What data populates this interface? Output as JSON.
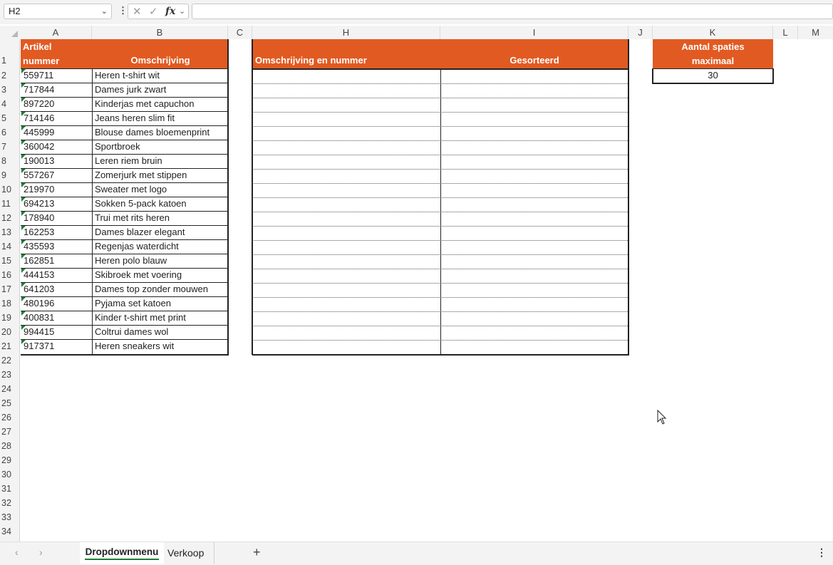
{
  "name_box": "H2",
  "formula_bar": {
    "fx_label": "fx",
    "formula": ""
  },
  "columns": [
    "A",
    "B",
    "C",
    "H",
    "I",
    "J",
    "K",
    "L",
    "M"
  ],
  "rows": [
    "1",
    "2",
    "3",
    "4",
    "5",
    "6",
    "7",
    "8",
    "9",
    "10",
    "11",
    "12",
    "13",
    "14",
    "15",
    "16",
    "17",
    "18",
    "19",
    "20",
    "21",
    "22",
    "23",
    "24",
    "25",
    "26",
    "27",
    "28",
    "29",
    "30",
    "31",
    "32",
    "33",
    "34"
  ],
  "table1": {
    "header_a_line1": "Artikel",
    "header_a_line2": "nummer",
    "header_b": "Omschrijving",
    "items": [
      {
        "nummer": "559711",
        "omschrijving": "Heren t-shirt wit"
      },
      {
        "nummer": "717844",
        "omschrijving": "Dames jurk zwart"
      },
      {
        "nummer": "897220",
        "omschrijving": "Kinderjas met capuchon"
      },
      {
        "nummer": "714146",
        "omschrijving": "Jeans heren slim fit"
      },
      {
        "nummer": "445999",
        "omschrijving": "Blouse dames bloemenprint"
      },
      {
        "nummer": "360042",
        "omschrijving": "Sportbroek"
      },
      {
        "nummer": "190013",
        "omschrijving": "Leren riem bruin"
      },
      {
        "nummer": "557267",
        "omschrijving": "Zomerjurk met stippen"
      },
      {
        "nummer": "219970",
        "omschrijving": "Sweater met logo"
      },
      {
        "nummer": "694213",
        "omschrijving": "Sokken 5-pack katoen"
      },
      {
        "nummer": "178940",
        "omschrijving": "Trui met rits heren"
      },
      {
        "nummer": "162253",
        "omschrijving": "Dames blazer elegant"
      },
      {
        "nummer": "435593",
        "omschrijving": "Regenjas waterdicht"
      },
      {
        "nummer": "162851",
        "omschrijving": "Heren polo blauw"
      },
      {
        "nummer": "444153",
        "omschrijving": "Skibroek met voering"
      },
      {
        "nummer": "641203",
        "omschrijving": "Dames top zonder mouwen"
      },
      {
        "nummer": "480196",
        "omschrijving": "Pyjama set katoen"
      },
      {
        "nummer": "400831",
        "omschrijving": "Kinder t-shirt met print"
      },
      {
        "nummer": "994415",
        "omschrijving": "Coltrui dames wol"
      },
      {
        "nummer": "917371",
        "omschrijving": "Heren sneakers wit"
      }
    ]
  },
  "table2": {
    "header_h": "Omschrijving en nummer",
    "header_i": "Gesorteerd"
  },
  "table3": {
    "header_line1": "Aantal spaties",
    "header_line2": "maximaal",
    "value": "30"
  },
  "sheet_tabs": [
    {
      "label": "Dropdownmenu",
      "active": true
    },
    {
      "label": "Verkoop",
      "active": false
    }
  ],
  "colors": {
    "header_fill": "#e15a22",
    "active_tab_underline": "#1e7e34",
    "tick": "#1e7e34"
  }
}
